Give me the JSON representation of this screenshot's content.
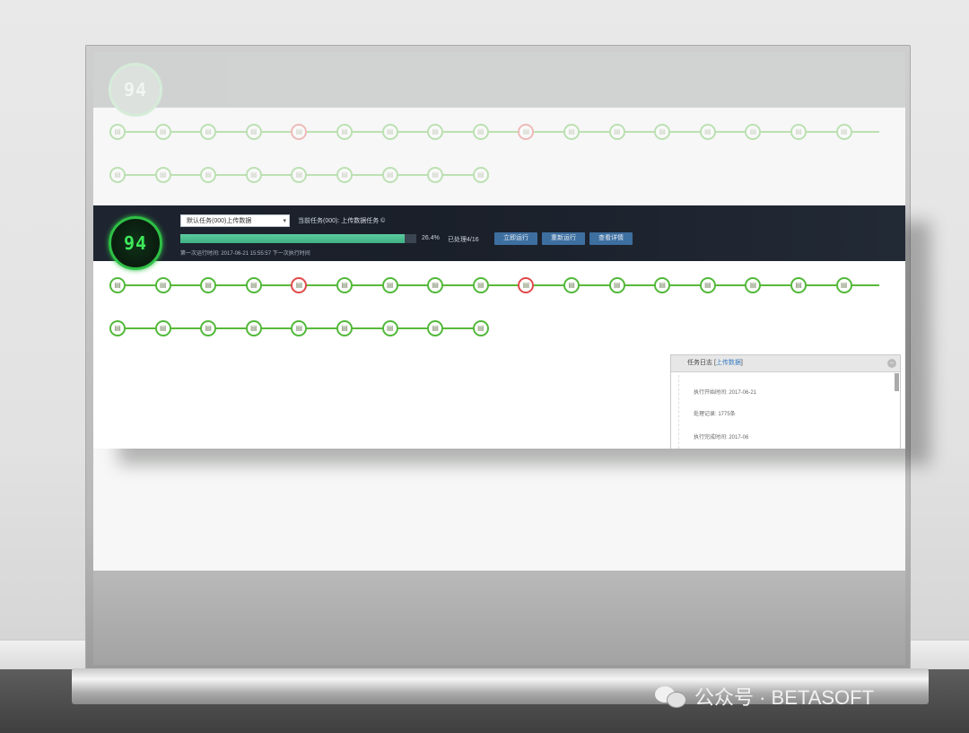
{
  "app": {
    "gauge_value": "94",
    "task_select": "默认任务(000)上传数据",
    "task_title": "当前任务(000): 上传数据任务 ©",
    "progress_pct": "26.4%",
    "progress_fraction": 0.95,
    "stat_text": "已处理4/16",
    "buttons": [
      {
        "label": "立即运行"
      },
      {
        "label": "重新运行"
      },
      {
        "label": "查看详情"
      }
    ],
    "meta_text": "第一次运行时间: 2017-06-21 15:55:57    下一次执行时间",
    "nodes_row1_count": 17,
    "nodes_row1_errors": [
      4,
      9
    ],
    "nodes_row2_count": 9,
    "node_icon": "file-icon"
  },
  "log_window": {
    "title_prefix": "任务日志 [",
    "title_highlight": "上传数据",
    "title_suffix": "]",
    "lines": [
      "执行开始时间: 2017-06-21",
      "处理记录: 1775条",
      "执行完成时间: 2017-06"
    ]
  },
  "watermark": {
    "text": "公众号 · BETASOFT"
  },
  "colors": {
    "header_bg": "#1e2430",
    "accent_green": "#52b83a",
    "error_red": "#e04b4b",
    "button_blue": "#3d6fa0",
    "progress_green": "#4fbf8f"
  }
}
